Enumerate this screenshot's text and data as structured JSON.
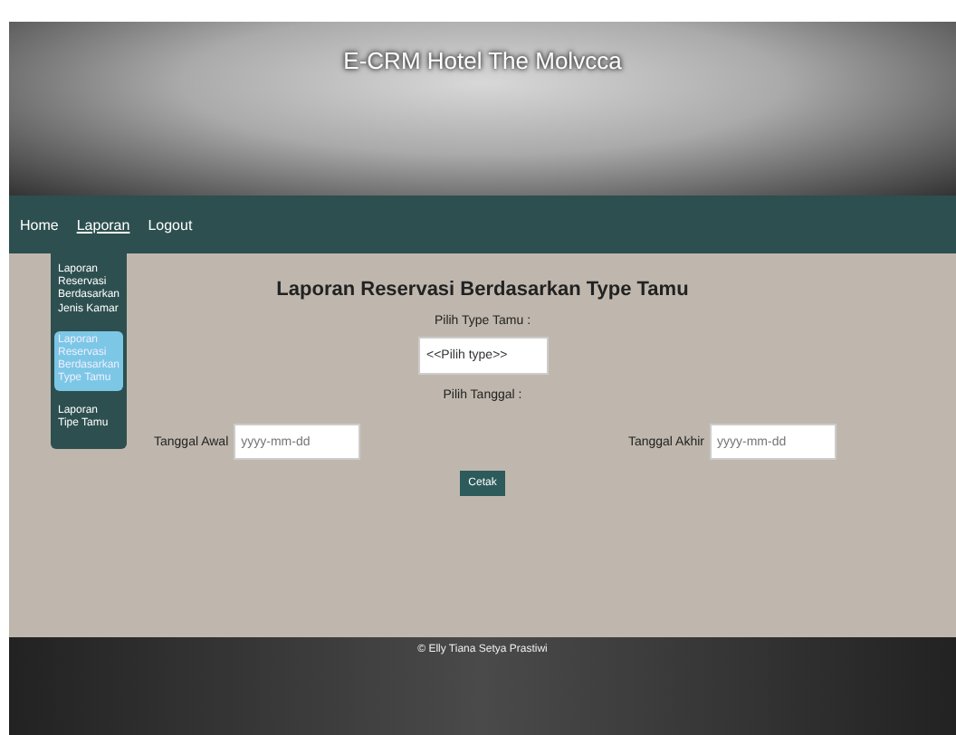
{
  "header": {
    "title": "E-CRM Hotel The Molvcca"
  },
  "nav": [
    {
      "label": "Home",
      "expanded": false
    },
    {
      "label": "Laporan",
      "expanded": true
    },
    {
      "label": "Logout",
      "expanded": false
    }
  ],
  "dropdown": [
    {
      "label": "Laporan Reservasi Berdasarkan Jenis Kamar",
      "selected": false
    },
    {
      "label": "Laporan Reservasi Berdasarkan Type Tamu",
      "selected": true
    },
    {
      "label": "Laporan Tipe Tamu",
      "selected": false
    }
  ],
  "form": {
    "title": "Laporan Reservasi Berdasarkan Type Tamu",
    "type_label": "Pilih Type Tamu :",
    "type_value": "<<Pilih type>>",
    "date_label": "Pilih Tanggal :",
    "start_label": "Tanggal Awal",
    "start_placeholder": "yyyy-mm-dd",
    "end_label": "Tanggal Akhir",
    "end_placeholder": "yyyy-mm-dd",
    "button": "Cetak"
  },
  "footer": {
    "text": "© Elly Tiana Setya Prastiwi"
  }
}
